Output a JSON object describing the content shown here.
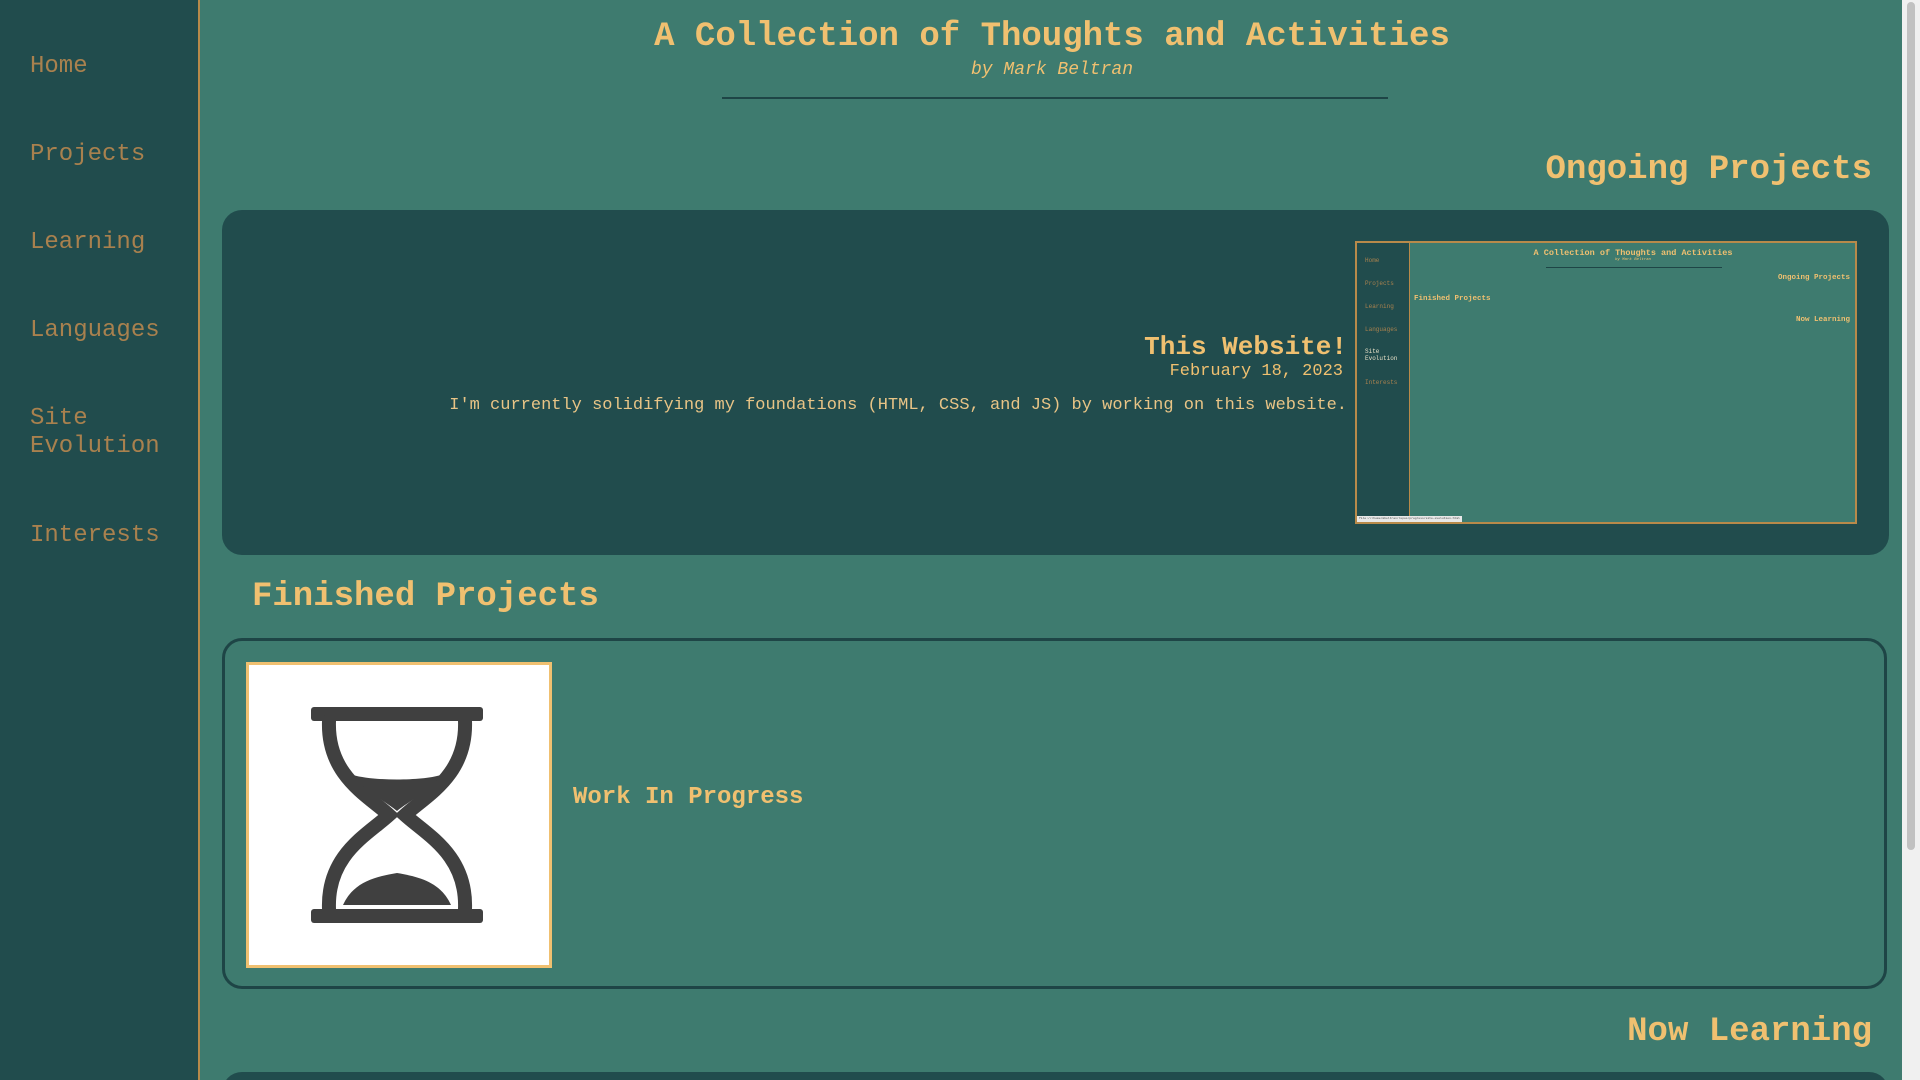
{
  "sidebar": {
    "items": [
      {
        "label": "Home"
      },
      {
        "label": "Projects"
      },
      {
        "label": "Learning"
      },
      {
        "label": "Languages"
      },
      {
        "label": "Site\nEvolution"
      },
      {
        "label": "Interests"
      }
    ]
  },
  "header": {
    "title": "A Collection of Thoughts and Activities",
    "subtitle": "by Mark Beltran"
  },
  "sections": {
    "ongoing": {
      "heading": "Ongoing Projects",
      "project": {
        "title": "This Website!",
        "date": "February 18, 2023",
        "description": "I'm currently solidifying my foundations (HTML, CSS, and JS) by working on this website."
      },
      "thumbnail": {
        "title": "A Collection of Thoughts and Activities",
        "subtitle": "by Mark Beltran",
        "ongoing": "Ongoing Projects",
        "finished": "Finished Projects",
        "learning": "Now Learning",
        "nav": [
          "Home",
          "Projects",
          "Learning",
          "Languages",
          "Site",
          "Evolution",
          "Interests"
        ],
        "url": "file:///home/mbeltran/repos/progress/site-evolution.html"
      }
    },
    "finished": {
      "heading": "Finished Projects",
      "status": "Work In Progress",
      "icon": "hourglass-icon"
    },
    "learning": {
      "heading": "Now Learning"
    }
  },
  "colors": {
    "background": "#3e7b6f",
    "panel": "#214c4d",
    "accent": "#f0c070",
    "nav_text": "#a9814e"
  }
}
